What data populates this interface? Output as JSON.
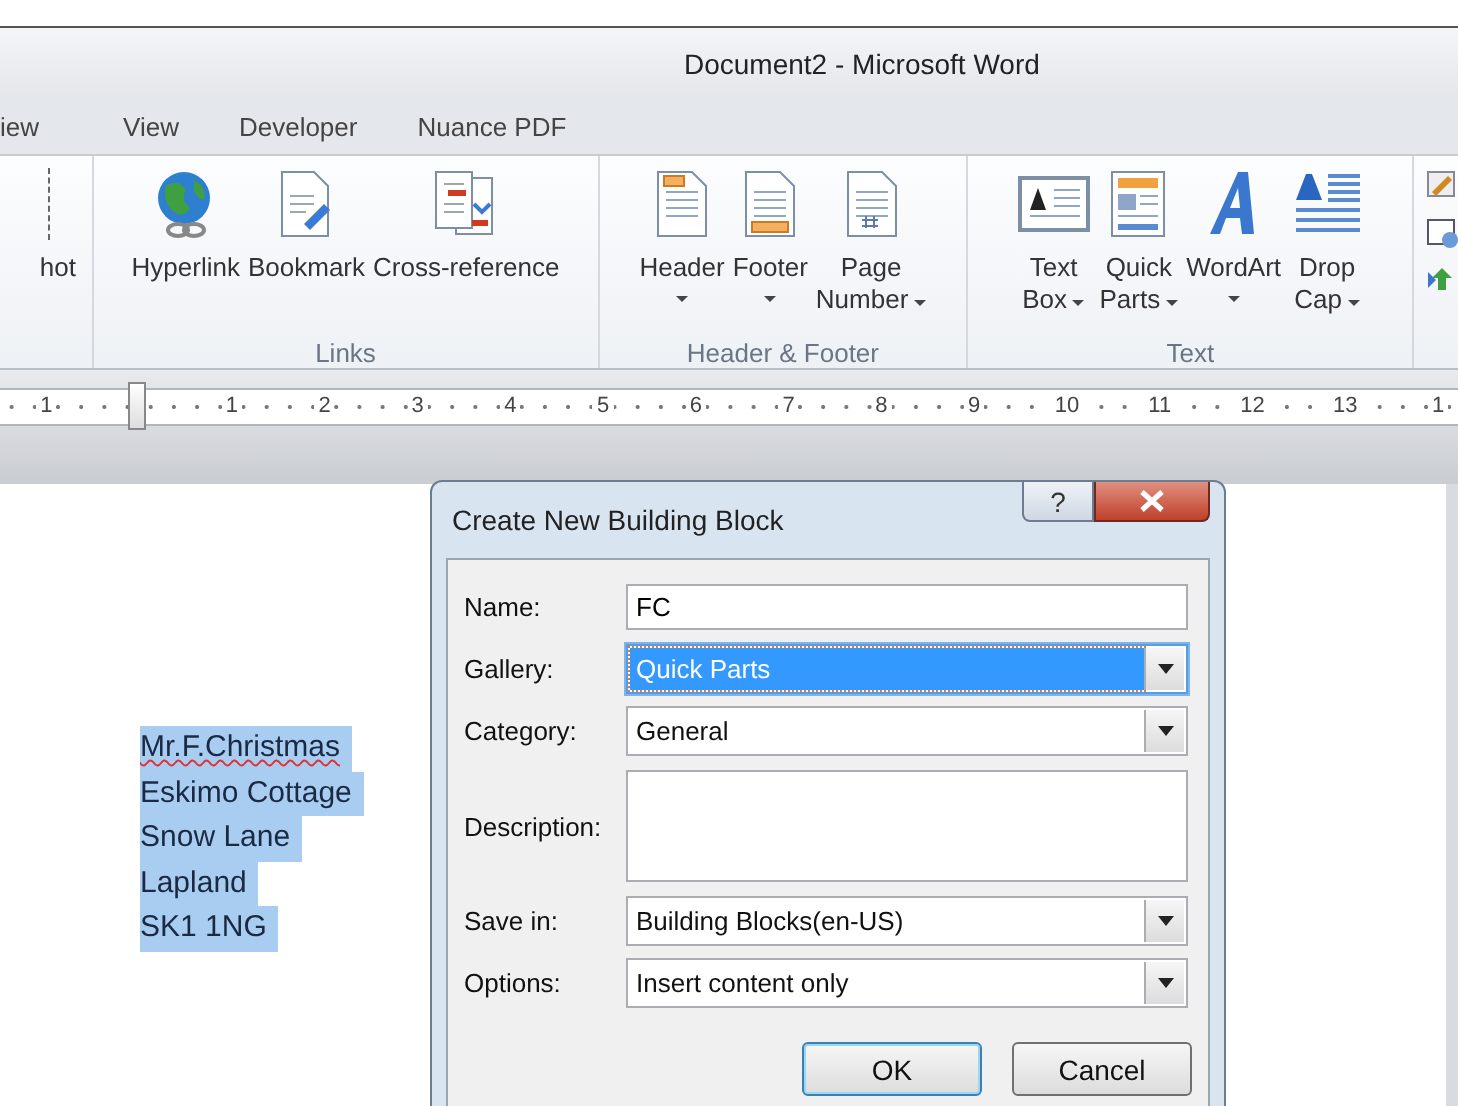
{
  "window": {
    "title": "Document2  -  Microsoft Word"
  },
  "tabs": [
    {
      "label": "iew",
      "selected": false
    },
    {
      "label": "View",
      "selected": false
    },
    {
      "label": "Developer",
      "selected": false
    },
    {
      "label": "Nuance PDF",
      "selected": false
    }
  ],
  "ribbon": {
    "groups": [
      {
        "items": [
          {
            "kind": "partial",
            "lines": [
              "hot"
            ],
            "dropdown": false
          }
        ]
      },
      {
        "label": "Links",
        "items": [
          {
            "kind": "hyperlink",
            "lines": [
              "Hyperlink"
            ],
            "dropdown": false
          },
          {
            "kind": "bookmark",
            "lines": [
              "Bookmark"
            ],
            "dropdown": false
          },
          {
            "kind": "crossref",
            "lines": [
              "Cross-reference"
            ],
            "dropdown": false
          }
        ]
      },
      {
        "label": "Header & Footer",
        "items": [
          {
            "kind": "header",
            "lines": [
              "Header"
            ],
            "dropdown": true
          },
          {
            "kind": "footer",
            "lines": [
              "Footer"
            ],
            "dropdown": true
          },
          {
            "kind": "pagenumber",
            "lines": [
              "Page",
              "Number"
            ],
            "dropdown": true
          }
        ]
      },
      {
        "label": "Text",
        "items": [
          {
            "kind": "textbox",
            "lines": [
              "Text",
              "Box"
            ],
            "dropdown": true
          },
          {
            "kind": "quickparts",
            "lines": [
              "Quick",
              "Parts"
            ],
            "dropdown": true
          },
          {
            "kind": "wordart",
            "lines": [
              "WordArt"
            ],
            "dropdown": true
          },
          {
            "kind": "dropcap",
            "lines": [
              "Drop",
              "Cap"
            ],
            "dropdown": true
          }
        ]
      }
    ]
  },
  "ruler": {
    "numbers": [
      "1",
      "1",
      "2",
      "3",
      "4",
      "5",
      "6",
      "7",
      "8",
      "9",
      "10",
      "11",
      "12",
      "13",
      "1"
    ]
  },
  "document": {
    "lines": [
      {
        "text": "Mr.F.Christmas",
        "misspelled": true,
        "selected": true
      },
      {
        "text": "Eskimo Cottage",
        "misspelled": false,
        "selected": true
      },
      {
        "text": "Snow Lane",
        "misspelled": false,
        "selected": true
      },
      {
        "text": "Lapland",
        "misspelled": false,
        "selected": true
      },
      {
        "text": "SK1 1NG",
        "misspelled": false,
        "selected": true
      }
    ]
  },
  "dialog": {
    "title": "Create New Building Block",
    "help": "?",
    "fields": [
      {
        "kind": "text",
        "label": "Name:",
        "value": "FC",
        "selected": false
      },
      {
        "kind": "combo",
        "label": "Gallery:",
        "value": "Quick Parts",
        "selected": true
      },
      {
        "kind": "combo",
        "label": "Category:",
        "value": "General",
        "selected": false
      },
      {
        "kind": "textarea",
        "label": "Description:",
        "selected": false
      },
      {
        "kind": "combo",
        "label": "Save in:",
        "value": "Building Blocks(en-US)",
        "selected": false
      },
      {
        "kind": "combo",
        "label": "Options:",
        "value": "Insert content only",
        "selected": false
      }
    ],
    "buttons": [
      {
        "label": "OK",
        "default": true
      },
      {
        "label": "Cancel",
        "default": false
      }
    ]
  }
}
